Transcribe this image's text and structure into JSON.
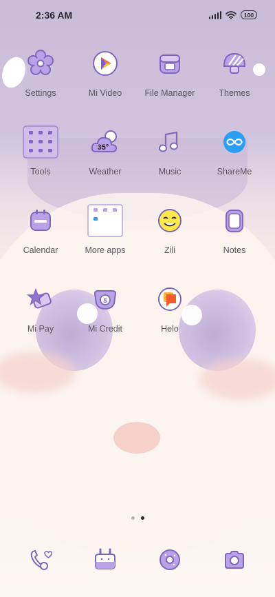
{
  "status_bar": {
    "time": "2:36 AM",
    "battery_level": "100",
    "icons": [
      "signal-icon",
      "wifi-icon",
      "battery-icon"
    ]
  },
  "apps": [
    {
      "id": "settings",
      "label": "Settings",
      "icon": "flower-gear-icon"
    },
    {
      "id": "mi-video",
      "label": "Mi Video",
      "icon": "play-triangle-icon"
    },
    {
      "id": "file-manager",
      "label": "File Manager",
      "icon": "folder-box-icon"
    },
    {
      "id": "themes",
      "label": "Themes",
      "icon": "striped-mushroom-icon"
    },
    {
      "id": "tools",
      "label": "Tools",
      "icon": "folder-grid-icon"
    },
    {
      "id": "weather",
      "label": "Weather",
      "icon": "cloud-sun-icon",
      "value": "35°"
    },
    {
      "id": "music",
      "label": "Music",
      "icon": "music-note-icon"
    },
    {
      "id": "shareme",
      "label": "ShareMe",
      "icon": "infinity-icon"
    },
    {
      "id": "calendar",
      "label": "Calendar",
      "icon": "calendar-icon"
    },
    {
      "id": "more-apps",
      "label": "More apps",
      "icon": "folder-grid-icon"
    },
    {
      "id": "zili",
      "label": "Zili",
      "icon": "smiley-face-icon"
    },
    {
      "id": "notes",
      "label": "Notes",
      "icon": "notepad-icon"
    },
    {
      "id": "mi-pay",
      "label": "Mi Pay",
      "icon": "star-card-icon"
    },
    {
      "id": "mi-credit",
      "label": "Mi Credit",
      "icon": "coin-wallet-icon"
    },
    {
      "id": "helo",
      "label": "Helo",
      "icon": "chat-bubble-icon"
    }
  ],
  "page_indicator": {
    "total": 2,
    "current": 2
  },
  "dock": [
    {
      "id": "phone",
      "icon": "phone-heart-icon"
    },
    {
      "id": "messages",
      "icon": "message-bunny-icon"
    },
    {
      "id": "browser",
      "icon": "donut-icon"
    },
    {
      "id": "camera",
      "icon": "camera-icon"
    }
  ],
  "colors": {
    "accent_purple": "#a892d8",
    "icon_fill": "#b9a3e6",
    "icon_stroke": "#7f67bd",
    "label_text": "#5b5560",
    "status_text": "#2a2530",
    "shareme_blue": "#2a9df4",
    "helo_orange": "#f2592b"
  }
}
